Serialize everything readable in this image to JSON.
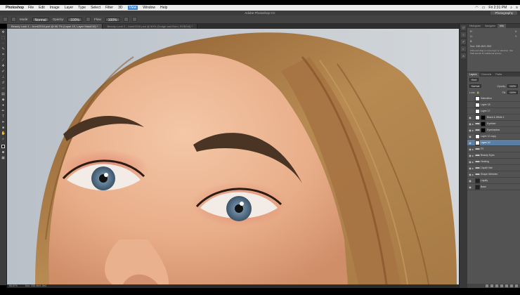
{
  "menubar": {
    "app": "Photoshop",
    "items": [
      "File",
      "Edit",
      "Image",
      "Layer",
      "Type",
      "Select",
      "Filter",
      "3D",
      "View",
      "Window",
      "Help"
    ],
    "active": "View",
    "clock": "Fri 2:31 PM"
  },
  "titlebar": {
    "title": "Adobe Photoshop CC",
    "workspace": "Photography"
  },
  "options": {
    "mode_label": "Mode:",
    "mode_value": "Normal",
    "opacity_label": "Opacity:",
    "opacity_value": "100%",
    "flow_label": "Flow:",
    "flow_value": "100%"
  },
  "tabs": [
    {
      "label": "Beauty Look 1 – bunt/2016.psd @ 66.7% (Layer 10, Layer Mask/16) *",
      "active": true
    },
    {
      "label": "Beauty Look 2 – bunt/2016.psd @ 50% (Dodge and Burn, RGB/16) *",
      "active": false
    }
  ],
  "status": {
    "zoom": "66.67%",
    "doc": "Doc: 338.4M/1.05G"
  },
  "panel": {
    "top_tabs": [
      "Histogram",
      "Navigator",
      "Info"
    ],
    "info": {
      "r": "R:",
      "g": "G:",
      "b": "B:",
      "x": "X:",
      "y": "Y:",
      "doc": "Doc: 338.4M/1.05G"
    },
    "hint": "Click and drag to move layer or selection. Use Shift and Alt for additional options.",
    "layer_tabs": [
      "Layers",
      "Channels",
      "Paths"
    ],
    "kind": "Kind",
    "blend": "Normal",
    "opacity_label": "Opacity:",
    "opacity": "100%",
    "lock_label": "Lock:",
    "fill_label": "Fill:",
    "fill": "100%"
  },
  "layers": [
    {
      "name": "Saturation",
      "vis": false,
      "thumb": "white",
      "mask": false,
      "folder": false,
      "selected": false
    },
    {
      "name": "Layer 18",
      "vis": false,
      "thumb": "white",
      "mask": false,
      "folder": false,
      "selected": false
    },
    {
      "name": "Layer 17",
      "vis": false,
      "thumb": "white",
      "mask": false,
      "folder": false,
      "selected": false
    },
    {
      "name": "Black & White 1",
      "vis": true,
      "thumb": "white",
      "mask": true,
      "folder": false,
      "selected": false
    },
    {
      "name": "Eyeliner",
      "vis": true,
      "thumb": "folder",
      "mask": true,
      "folder": true,
      "selected": false
    },
    {
      "name": "Eyeshadow",
      "vis": true,
      "thumb": "folder",
      "mask": true,
      "folder": true,
      "selected": false
    },
    {
      "name": "Layer 10 copy",
      "vis": true,
      "thumb": "white",
      "mask": false,
      "folder": false,
      "selected": false
    },
    {
      "name": "Layer 10",
      "vis": true,
      "thumb": "white",
      "mask": false,
      "folder": false,
      "selected": true
    },
    {
      "name": "FS",
      "vis": true,
      "thumb": "folder",
      "mask": false,
      "folder": true,
      "selected": false
    },
    {
      "name": "Beauty Eyes",
      "vis": true,
      "thumb": "folder",
      "mask": false,
      "folder": true,
      "selected": false
    },
    {
      "name": "Healing",
      "vis": true,
      "thumb": "folder",
      "mask": false,
      "folder": true,
      "selected": false
    },
    {
      "name": "Liquid Hair",
      "vis": true,
      "thumb": "folder",
      "mask": false,
      "folder": true,
      "selected": false
    },
    {
      "name": "Shape Wrinkles",
      "vis": true,
      "thumb": "folder",
      "mask": false,
      "folder": true,
      "selected": false
    },
    {
      "name": "Liquify",
      "vis": true,
      "thumb": "dark",
      "mask": false,
      "folder": false,
      "selected": false
    },
    {
      "name": "Base",
      "vis": true,
      "thumb": "dark",
      "mask": false,
      "folder": false,
      "selected": false
    }
  ]
}
